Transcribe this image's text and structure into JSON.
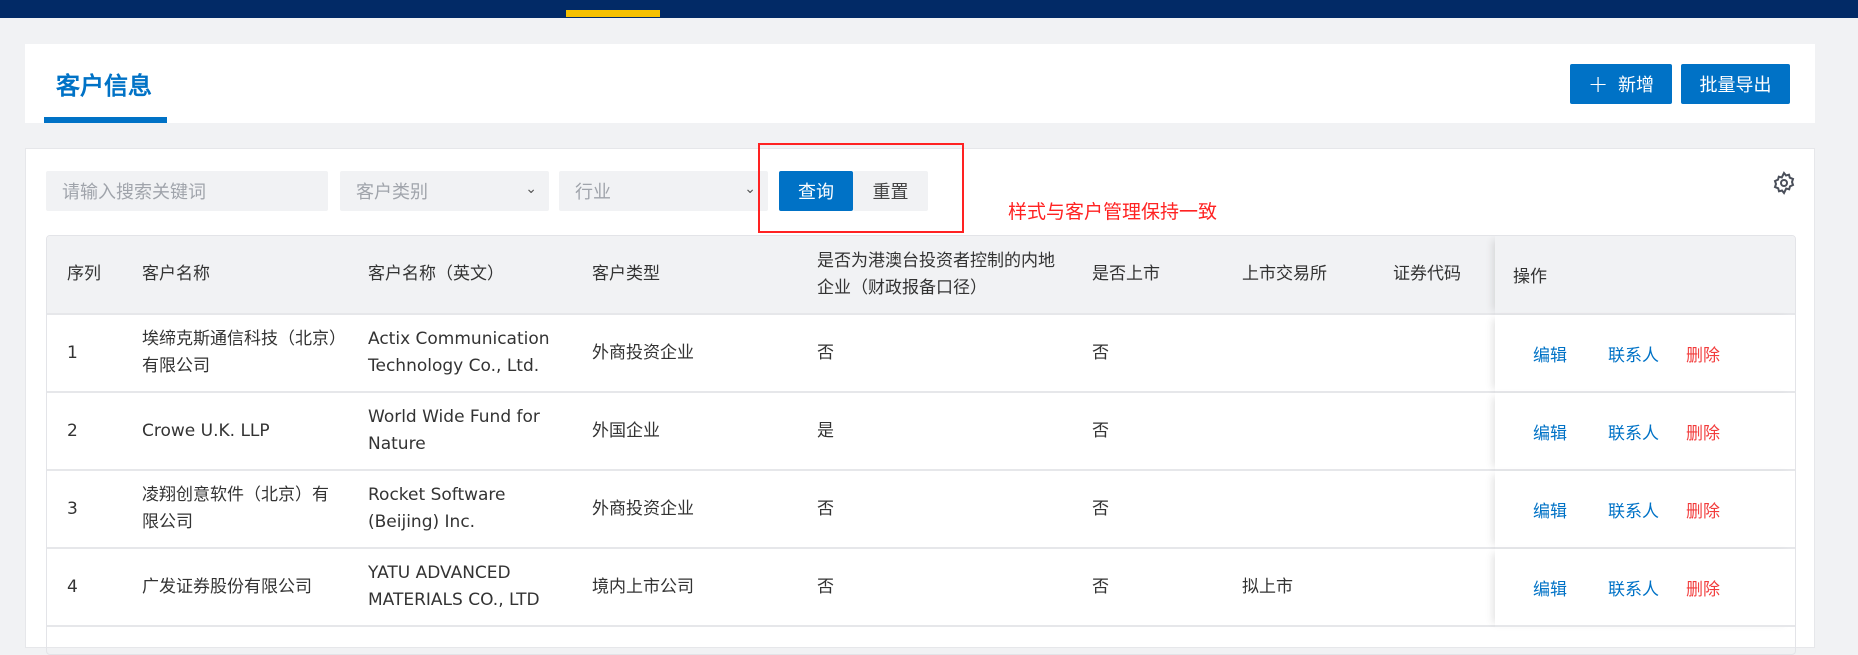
{
  "header": {
    "title": "客户信息",
    "add_label": "新增",
    "export_label": "批量导出"
  },
  "filters": {
    "search_placeholder": "请输入搜索关键词",
    "type_placeholder": "客户类别",
    "industry_placeholder": "行业",
    "query_label": "查询",
    "reset_label": "重置"
  },
  "annotation": "样式与客户管理保持一致",
  "colors": {
    "primary": "#0072c6",
    "topbar": "#022a66",
    "accent": "#f5c000",
    "danger": "#f23c3c"
  },
  "table": {
    "columns": [
      "序列",
      "客户名称",
      "客户名称（英文）",
      "客户类型",
      "是否为港澳台投资者控制的内地企业（财政报备口径）",
      "是否上市",
      "上市交易所",
      "证券代码",
      "操作"
    ],
    "actions": {
      "edit": "编辑",
      "contacts": "联系人",
      "delete": "删除"
    },
    "rows": [
      [
        "1",
        "埃缔克斯通信科技（北京）有限公司",
        "Actix Communication Technology Co., Ltd.",
        "外商投资企业",
        "否",
        "否",
        "",
        ""
      ],
      [
        "2",
        "Crowe U.K. LLP",
        "World Wide Fund for Nature",
        "外国企业",
        "是",
        "否",
        "",
        ""
      ],
      [
        "3",
        "凌翔创意软件（北京）有限公司",
        "Rocket Software (Beijing) Inc.",
        "外商投资企业",
        "否",
        "否",
        "",
        ""
      ],
      [
        "4",
        "广发证券股份有限公司",
        "YATU ADVANCED MATERIALS CO., LTD",
        "境内上市公司",
        "否",
        "否",
        "拟上市",
        ""
      ]
    ]
  }
}
